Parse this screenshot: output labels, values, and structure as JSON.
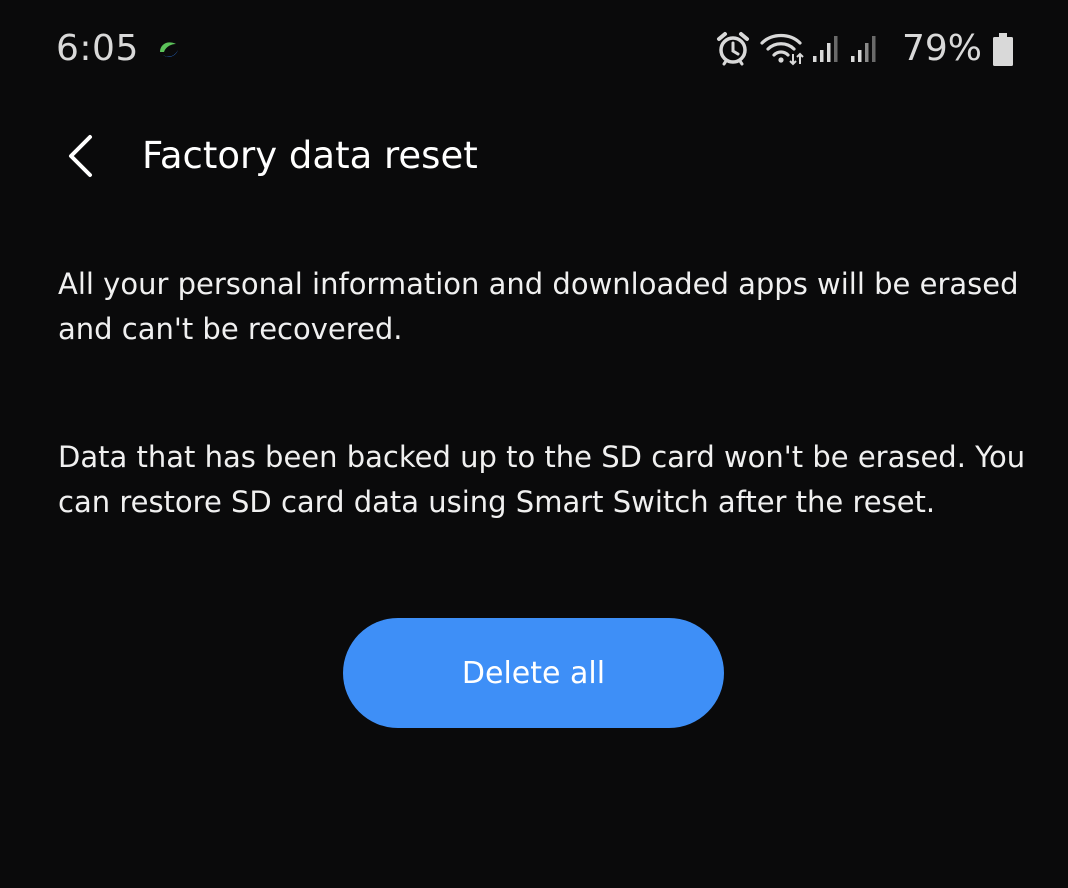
{
  "status_bar": {
    "time": "6:05",
    "battery_percent": "79%",
    "icons": [
      "app-notification-icon",
      "alarm-icon",
      "wifi-icon",
      "signal-icon",
      "signal-icon",
      "battery-icon"
    ]
  },
  "header": {
    "back_icon": "chevron-left-icon",
    "title": "Factory data reset"
  },
  "main": {
    "description_1": "All your personal information and downloaded apps will be erased and can't be recovered.",
    "description_2": "Data that has been backed up to the SD card won't be erased. You can restore SD card data using Smart Switch after the reset.",
    "delete_button_label": "Delete all"
  },
  "colors": {
    "background": "#0a0a0b",
    "accent_button": "#3e8ff7",
    "text": "#ffffff",
    "status_text": "#d9d9d9"
  }
}
